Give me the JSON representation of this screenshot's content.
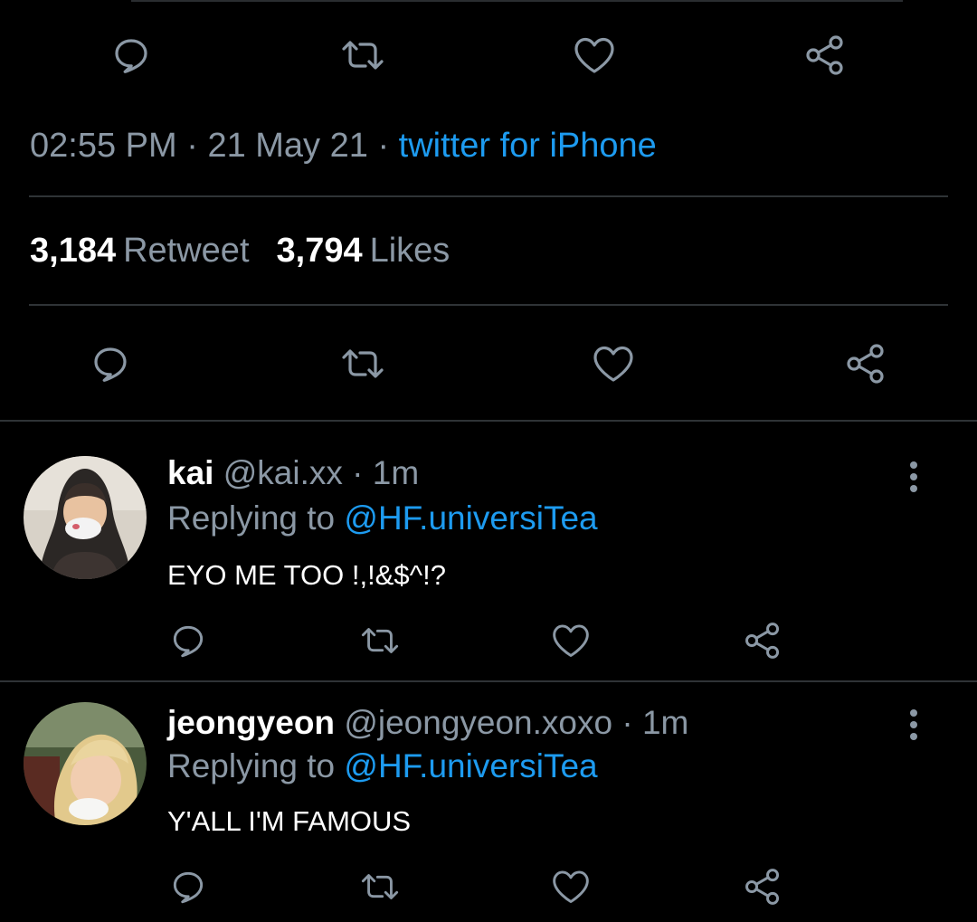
{
  "tweet": {
    "time": "02:55 PM",
    "separator": "·",
    "date": "21 May 21",
    "source": "twitter for iPhone",
    "retweets": "3,184",
    "retweets_label": "Retweet",
    "likes": "3,794",
    "likes_label": "Likes"
  },
  "icons": {
    "reply": "reply-icon",
    "retweet": "retweet-icon",
    "like": "heart-icon",
    "share": "share-icon",
    "more": "more-vertical-icon"
  },
  "colors": {
    "background": "#000000",
    "muted": "#8b98a5",
    "link": "#1d9bf0",
    "divider": "#2f3336"
  },
  "replies": [
    {
      "name": "kai",
      "handle": "@kai.xx",
      "separator": "·",
      "time": "1m",
      "replying_prefix": "Replying to",
      "replying_to": "@HF.universiTea",
      "text": "EYO ME TOO !,!&$^!?"
    },
    {
      "name": "jeongyeon",
      "handle": "@jeongyeon.xoxo",
      "separator": "·",
      "time": "1m",
      "replying_prefix": "Replying to",
      "replying_to": "@HF.universiTea",
      "text": "Y'ALL I'M FAMOUS"
    }
  ]
}
